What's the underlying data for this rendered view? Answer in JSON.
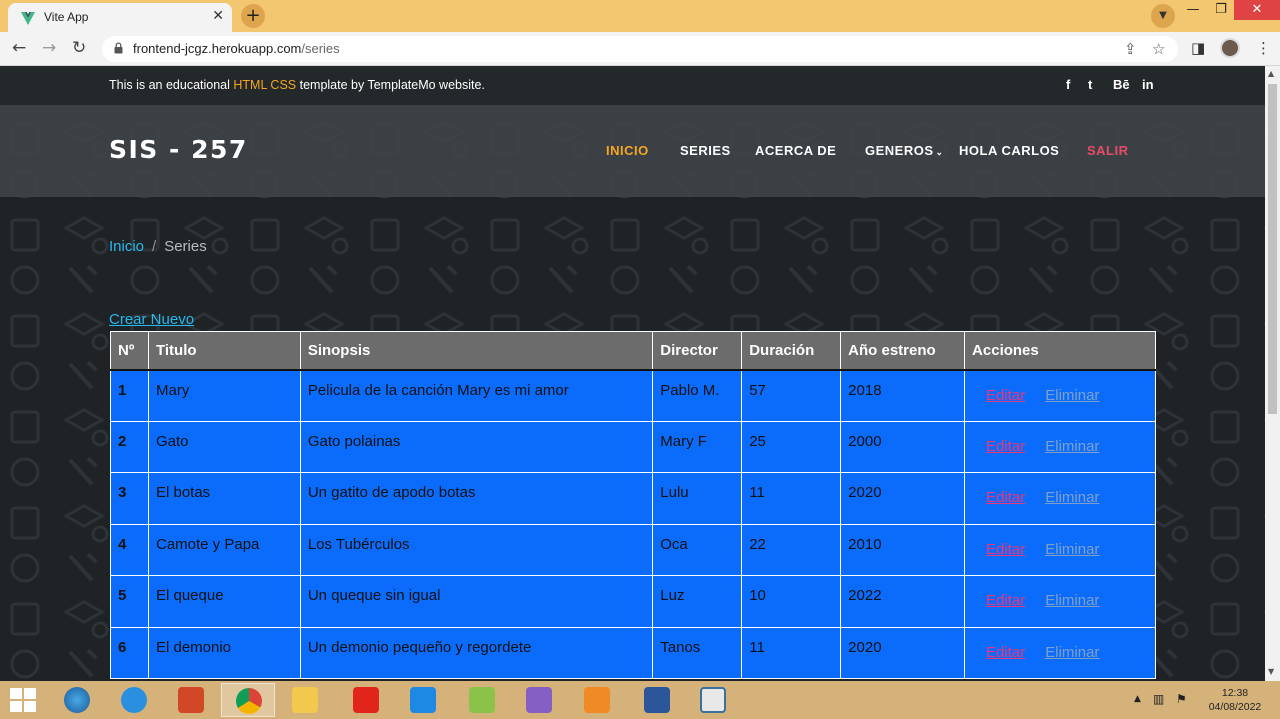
{
  "browser": {
    "tab_title": "Vite App",
    "url_host": "frontend-jcgz.herokuapp.com",
    "url_path": "/series"
  },
  "topbar": {
    "message_pre": "This is an educational ",
    "message_hl": "HTML CSS",
    "message_post": " template by TemplateMo website.",
    "social": [
      "f",
      "t",
      "Bē",
      "in"
    ]
  },
  "header": {
    "logo": "SIS - 257",
    "nav": [
      {
        "label": "INICIO"
      },
      {
        "label": "SERIES"
      },
      {
        "label": "ACERCA DE"
      },
      {
        "label": "GENEROS"
      },
      {
        "label": "HOLA CARLOS"
      },
      {
        "label": "SALIR"
      }
    ]
  },
  "breadcrumb": {
    "home": "Inicio",
    "sep": "/",
    "current": "Series"
  },
  "create_label": "Crear Nuevo",
  "table": {
    "headers": [
      "Nº",
      "Titulo",
      "Sinopsis",
      "Director",
      "Duración",
      "Año estreno",
      "Acciones"
    ],
    "rows": [
      {
        "n": "1",
        "titulo": "Mary",
        "sinopsis": "Pelicula de la canción Mary es mi amor",
        "director": "Pablo M.",
        "duracion": "57",
        "anio": "2018"
      },
      {
        "n": "2",
        "titulo": "Gato",
        "sinopsis": "Gato polainas",
        "director": "Mary F",
        "duracion": "25",
        "anio": "2000"
      },
      {
        "n": "3",
        "titulo": "El botas",
        "sinopsis": "Un gatito de apodo botas",
        "director": "Lulu",
        "duracion": "11",
        "anio": "2020"
      },
      {
        "n": "4",
        "titulo": "Camote y Papa",
        "sinopsis": "Los Tubérculos",
        "director": "Oca",
        "duracion": "22",
        "anio": "2010"
      },
      {
        "n": "5",
        "titulo": "El queque",
        "sinopsis": "Un queque sin igual",
        "director": "Luz",
        "duracion": "10",
        "anio": "2022"
      },
      {
        "n": "6",
        "titulo": "El demonio",
        "sinopsis": "Un demonio pequeño y regordete",
        "director": "Tanos",
        "duracion": "11",
        "anio": "2020"
      }
    ],
    "edit_label": "Editar",
    "delete_label": "Eliminar"
  },
  "taskbar": {
    "time": "12:38",
    "date": "04/08/2022"
  },
  "colors": {
    "accent_orange": "#f5a623",
    "link_blue": "#27b8ee",
    "row_blue": "#0b6cfc",
    "edit_pink": "#e8377a"
  }
}
